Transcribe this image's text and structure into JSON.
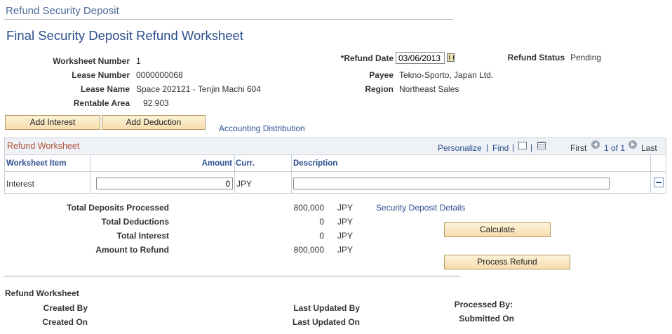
{
  "page_header": "Refund Security Deposit",
  "page_title": "Final Security Deposit Refund Worksheet",
  "fields": {
    "worksheet_number": {
      "label": "Worksheet Number",
      "value": "1"
    },
    "lease_number": {
      "label": "Lease Number",
      "value": "0000000068"
    },
    "lease_name": {
      "label": "Lease Name",
      "value": "Space 202121 - Tenjin Machi 604"
    },
    "rentable_area": {
      "label": "Rentable Area",
      "value": "92.903"
    },
    "refund_date": {
      "label": "*Refund Date",
      "value": "03/06/2013"
    },
    "payee": {
      "label": "Payee",
      "value": "Tekno-Sporto, Japan Ltd."
    },
    "region": {
      "label": "Region",
      "value": "Northeast Sales"
    },
    "refund_status": {
      "label": "Refund Status",
      "value": "Pending"
    }
  },
  "buttons": {
    "add_interest": "Add Interest",
    "add_deduction": "Add Deduction",
    "calculate": "Calculate",
    "process_refund": "Process Refund"
  },
  "links": {
    "accounting_distribution": "Accounting Distribution",
    "security_deposit_details": "Security Deposit Details"
  },
  "grid": {
    "title": "Refund Worksheet",
    "personalize": "Personalize",
    "separator": "|",
    "find": "Find",
    "first": "First",
    "range": "1 of 1",
    "last": "Last",
    "columns": {
      "item": "Worksheet Item",
      "amount": "Amount",
      "curr": "Curr.",
      "description": "Description"
    },
    "rows": [
      {
        "item": "Interest",
        "amount": "0",
        "curr": "JPY",
        "description": ""
      }
    ]
  },
  "totals": [
    {
      "label": "Total Deposits Processed",
      "value": "800,000",
      "curr": "JPY"
    },
    {
      "label": "Total Deductions",
      "value": "0",
      "curr": "JPY"
    },
    {
      "label": "Total Interest",
      "value": "0",
      "curr": "JPY"
    },
    {
      "label": "Amount to Refund",
      "value": "800,000",
      "curr": "JPY"
    }
  ],
  "footer": {
    "section_title": "Refund Worksheet",
    "created_by": "Created By",
    "created_on": "Created On",
    "last_updated_by": "Last Updated By",
    "last_updated_on": "Last Updated On",
    "processed_by": "Processed By:",
    "submitted_on": "Submitted On"
  }
}
